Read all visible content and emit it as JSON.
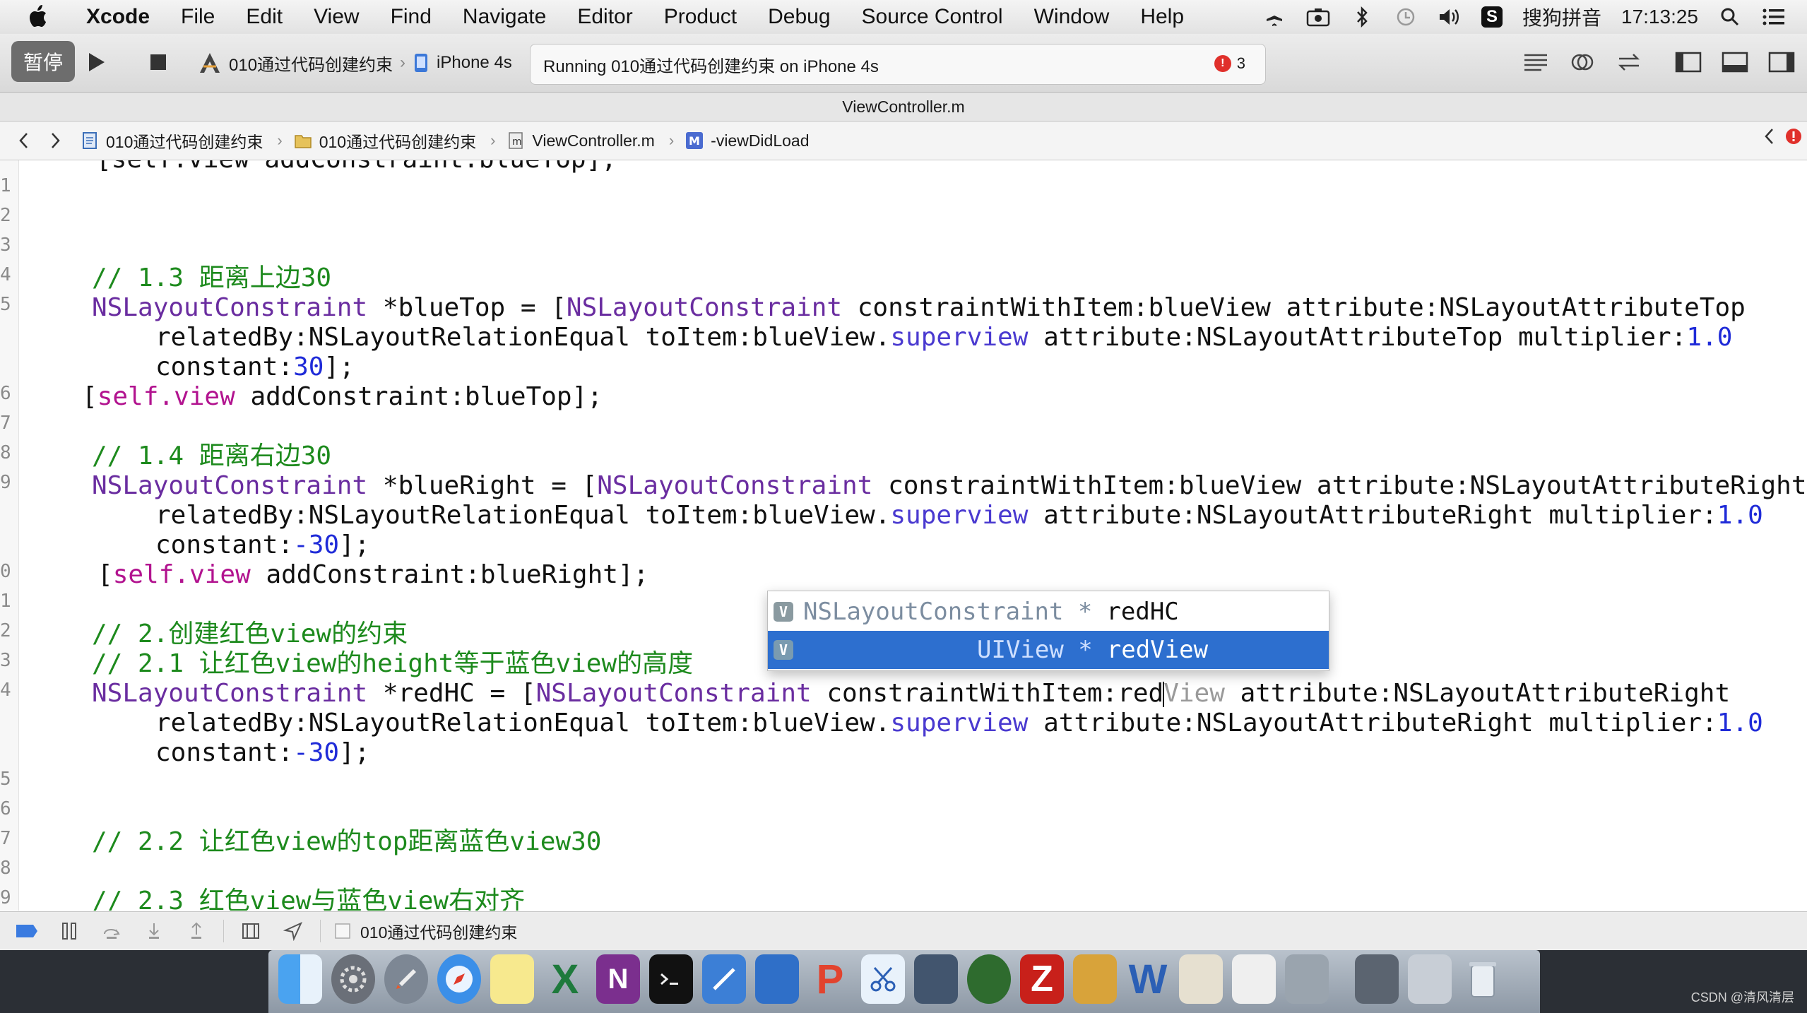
{
  "menubar": {
    "app": "Xcode",
    "items": [
      "File",
      "Edit",
      "View",
      "Find",
      "Navigate",
      "Editor",
      "Product",
      "Debug",
      "Source Control",
      "Window",
      "Help"
    ],
    "ime": "搜狗拼音",
    "clock": "17:13:25"
  },
  "toolbar": {
    "pause_label": "暂停",
    "scheme_name": "010通过代码创建约束",
    "device_name": "iPhone 4s",
    "status": "Running 010通过代码创建约束 on iPhone 4s",
    "error_count": "3"
  },
  "titlebar": {
    "filename": "ViewController.m"
  },
  "jumpbar": {
    "crumbs": [
      "010通过代码创建约束",
      "010通过代码创建约束",
      "ViewController.m",
      "-viewDidLoad"
    ]
  },
  "editor": {
    "gutter": [
      "1",
      "2",
      "3",
      "4",
      "5",
      "",
      "",
      "6",
      "7",
      "8",
      "9",
      "",
      "",
      "0",
      "1",
      "2",
      "3",
      "4",
      "",
      "",
      "5",
      "6",
      "7",
      "8",
      "9"
    ],
    "lines": {
      "l_top": "[self.view addConstraint:blueTop];",
      "c13": "// 1.3 距离上边30",
      "l5a_type": "NSLayoutConstraint",
      "l5a_rest1": " *blueTop = [",
      "l5a_type2": "NSLayoutConstraint",
      "l5a_rest2": " constraintWithItem:blueView attribute:NSLayoutAttributeTop",
      "l5b_a": "relatedBy:NSLayoutRelationEqual toItem:blueView.",
      "l5b_prop": "superview",
      "l5b_b": " attribute:NSLayoutAttributeTop multiplier:",
      "l5b_num": "1.0",
      "l5c_a": "constant:",
      "l5c_num": "30",
      "l5c_b": "];",
      "l6_a": "[",
      "l6_self": "self",
      "l6_dot": ".",
      "l6_view": "view",
      "l6_b": " addConstraint:blueTop];",
      "c14": "// 1.4 距离右边30",
      "l9a_type": "NSLayoutConstraint",
      "l9a_rest1": " *blueRight = [",
      "l9a_type2": "NSLayoutConstraint",
      "l9a_rest2": " constraintWithItem:blueView attribute:NSLayoutAttributeRight",
      "l9b_a": "relatedBy:NSLayoutRelationEqual toItem:blueView.",
      "l9b_prop": "superview",
      "l9b_b": " attribute:NSLayoutAttributeRight multiplier:",
      "l9b_num": "1.0",
      "l9c_a": "constant:",
      "l9c_num": "-30",
      "l9c_b": "];",
      "l10_a": "[",
      "l10_self": "self",
      "l10_dot": ".",
      "l10_view": "view",
      "l10_b": " addConstraint:blueRight];",
      "c2": "// 2.创建红色view的约束",
      "c21": "// 2.1 让红色view的height等于蓝色view的高度",
      "l14a_type": "NSLayoutConstraint",
      "l14a_rest1": " *redHC = [",
      "l14a_type2": "NSLayoutConstraint",
      "l14a_rest2": " constraintWithItem:red",
      "l14a_ghost": "View",
      "l14a_rest3": " attribute:NSLayoutAttributeRight",
      "l14b_a": "relatedBy:NSLayoutRelationEqual toItem:blueView.",
      "l14b_prop": "superview",
      "l14b_b": " attribute:NSLayoutAttributeRight multiplier:",
      "l14b_num": "1.0",
      "l14c_a": "constant:",
      "l14c_num": "-30",
      "l14c_b": "];",
      "c22": "// 2.2 让红色view的top距离蓝色view30",
      "c23": "// 2.3 红色view与蓝色view右对齐"
    }
  },
  "autocomplete": {
    "items": [
      {
        "badge": "V",
        "type": "NSLayoutConstraint *",
        "name": "redHC"
      },
      {
        "badge": "V",
        "type": "UIView *",
        "name": "redView"
      }
    ],
    "selected_index": 1
  },
  "debugbar": {
    "target": "010通过代码创建约束"
  },
  "watermark": "CSDN @清风清层",
  "colors": {
    "comment": "#1d8a1d",
    "type": "#6a2da0",
    "keyword": "#b2138f",
    "number": "#1f2bd8",
    "selection": "#2d6fcf",
    "error": "#e0302b"
  }
}
